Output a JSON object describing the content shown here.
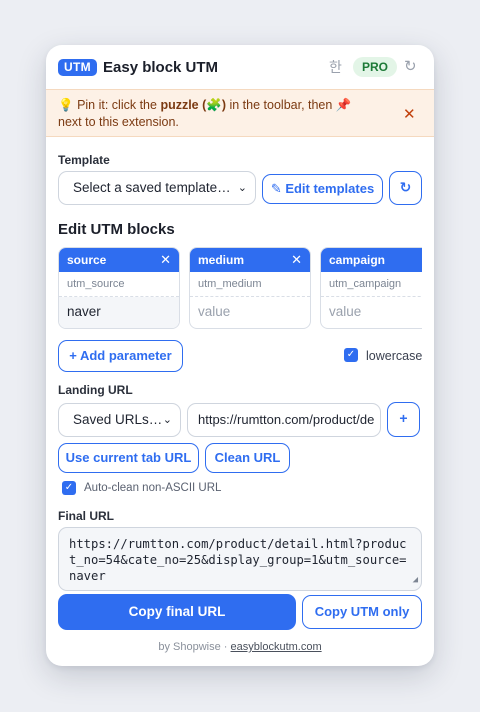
{
  "header": {
    "badge": "UTM",
    "title": "Easy block UTM",
    "lang_label": "한",
    "pro_label": "PRO",
    "refresh_glyph": "↻"
  },
  "notice": {
    "prefix_emoji": "💡",
    "text_1": "Pin it: click the",
    "bold": "puzzle (🧩)",
    "text_2": "in the toolbar, then",
    "pin_emoji": "📌",
    "text_3": "next to this extension.",
    "close_glyph": "✕"
  },
  "template": {
    "label": "Template",
    "select_value": "Select a saved template…",
    "edit_button": "✎ Edit templates",
    "refresh_glyph": "↻"
  },
  "utm": {
    "heading": "Edit UTM blocks",
    "blocks": [
      {
        "title": "source",
        "key": "utm_source",
        "value": "naver",
        "placeholder": "value"
      },
      {
        "title": "medium",
        "key": "utm_medium",
        "value": "",
        "placeholder": "value"
      },
      {
        "title": "campaign",
        "key": "utm_campaign",
        "value": "",
        "placeholder": "value"
      }
    ],
    "close_glyph": "✕",
    "add_button": "+ Add parameter",
    "lowercase_label": "lowercase",
    "lowercase_checked": true
  },
  "landing": {
    "label": "Landing URL",
    "saved_select": "Saved URLs…",
    "url_value": "https://rumtton.com/product/de",
    "add_glyph": "+",
    "use_current_button": "Use current tab URL",
    "clean_button": "Clean URL",
    "autoclean_label": "Auto-clean non-ASCII URL",
    "autoclean_checked": true
  },
  "final": {
    "label": "Final URL",
    "value": "https://rumtton.com/product/detail.html?product_no=54&cate_no=25&display_group=1&utm_source=naver",
    "copy_final": "Copy final URL",
    "copy_utm": "Copy UTM only"
  },
  "footer": {
    "by_text": "by Shopwise ·",
    "link_text": "easyblockutm.com"
  },
  "colors": {
    "accent": "#2f6df0",
    "pro_bg": "#e3f5e7",
    "notice_bg": "#fdf1e6"
  }
}
